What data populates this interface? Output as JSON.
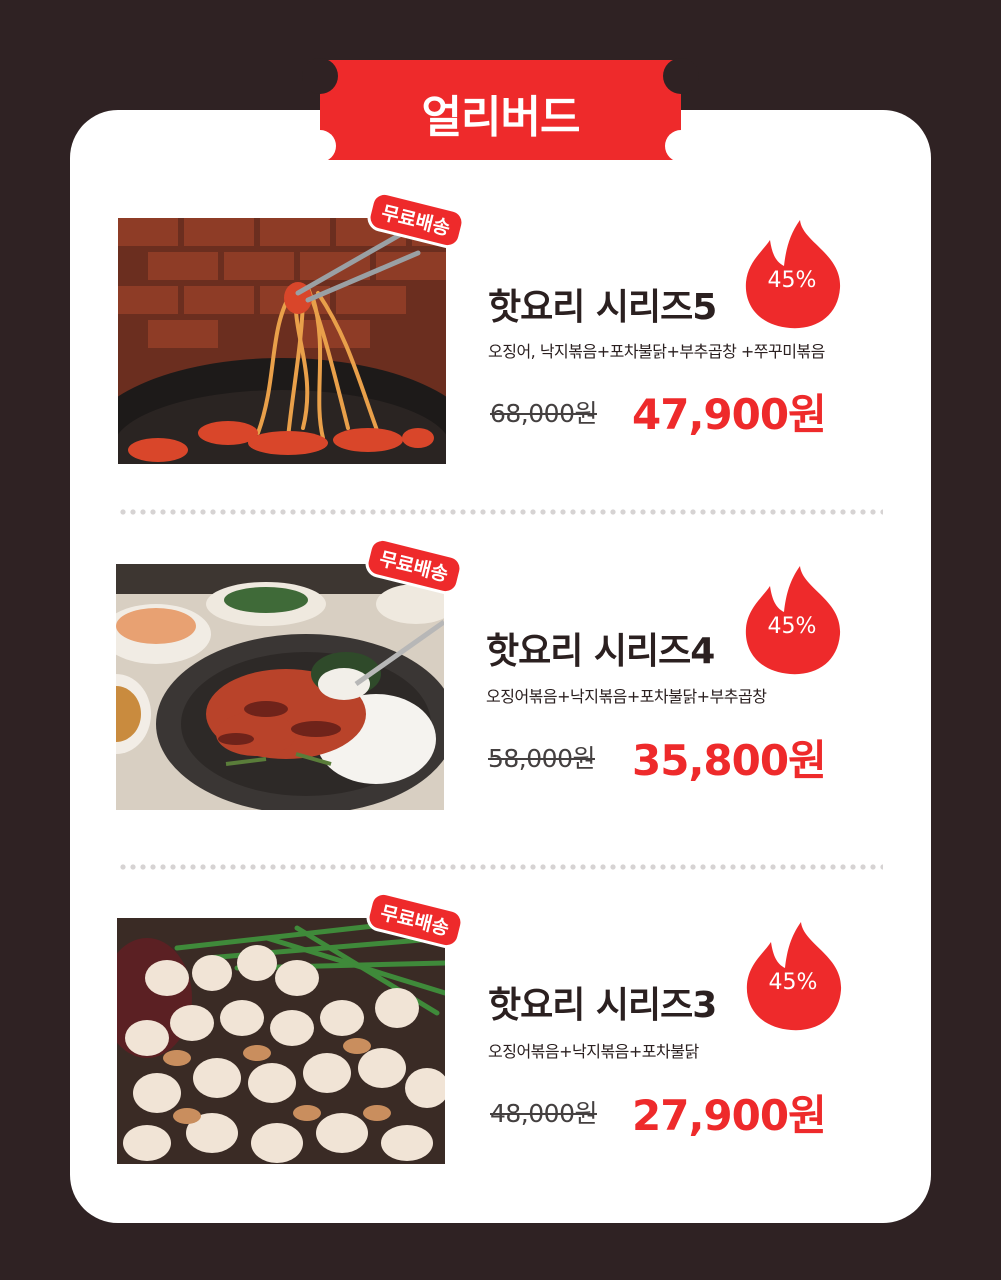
{
  "header": {
    "banner_label": "얼리버드"
  },
  "theme": {
    "background": "#2f2223",
    "card": "#ffffff",
    "accent": "#ee2a2b",
    "text": "#2b2020"
  },
  "products": [
    {
      "badge": "무료배송",
      "title": "핫요리 시리즈5",
      "description": "오징어, 낙지볶음+포차불닭+부추곱창 +쭈꾸미볶음",
      "original_price": "68,000원",
      "sale_price": "47,900원",
      "discount": "45%",
      "photo_icon": "stir-fried-noodles-photo"
    },
    {
      "badge": "무료배송",
      "title": "핫요리 시리즈4",
      "description": "오징어볶음+낙지볶음+포차불닭+부추곱창",
      "original_price": "58,000원",
      "sale_price": "35,800원",
      "discount": "45%",
      "photo_icon": "spicy-stir-fry-rice-photo"
    },
    {
      "badge": "무료배송",
      "title": "핫요리 시리즈3",
      "description": "오징어볶음+낙지볶음+포차불닭",
      "original_price": "48,000원",
      "sale_price": "27,900원",
      "discount": "45%",
      "photo_icon": "grilled-gopchang-photo"
    }
  ]
}
